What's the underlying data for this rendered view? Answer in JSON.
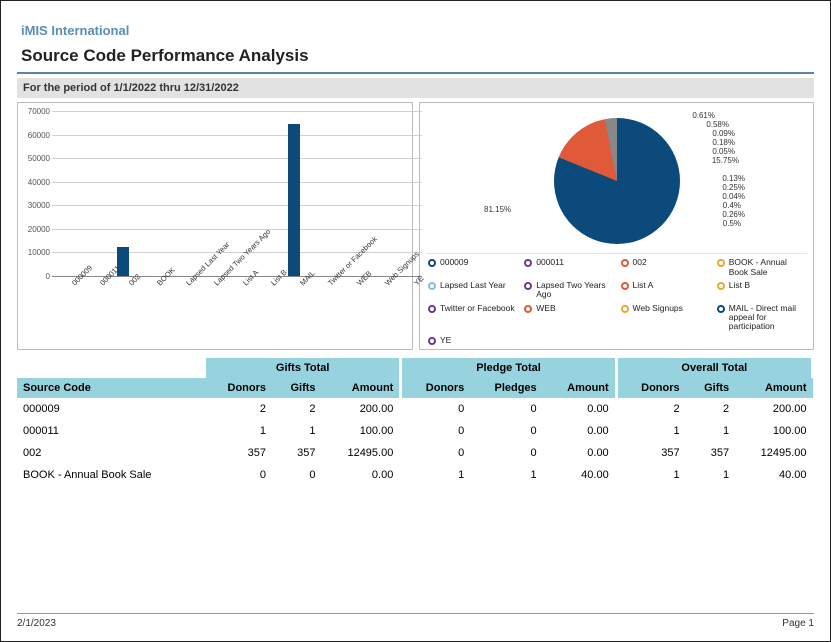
{
  "org_name": "iMIS International",
  "report_title": "Source Code Performance Analysis",
  "period_label": "For the period of 1/1/2022 thru 12/31/2022",
  "footer": {
    "date": "2/1/2023",
    "page": "Page 1"
  },
  "chart_data": [
    {
      "type": "bar",
      "categories": [
        "000009",
        "000011",
        "002",
        "BOOK",
        "Lapsed Last Year",
        "Lapsed Two Years Ago",
        "List A",
        "List B",
        "MAIL",
        "Twitter or Facebook",
        "WEB",
        "Web Signups",
        "YE"
      ],
      "values": [
        200,
        100,
        12495,
        40,
        0,
        0,
        0,
        0,
        64500,
        0,
        0,
        0,
        0
      ],
      "ylim": [
        0,
        70000
      ],
      "yticks": [
        0,
        10000,
        20000,
        30000,
        40000,
        50000,
        60000,
        70000
      ],
      "title": "",
      "xlabel": "",
      "ylabel": ""
    },
    {
      "type": "pie",
      "title": "",
      "series": [
        {
          "name": "000009",
          "value": 0.25,
          "color": "#0b4a7a"
        },
        {
          "name": "000011",
          "value": 0.13,
          "color": "#6b3a8c"
        },
        {
          "name": "002",
          "value": 15.75,
          "color": "#e05a3a"
        },
        {
          "name": "BOOK - Annual Book Sale",
          "value": 0.05,
          "color": "#e8a933"
        },
        {
          "name": "Lapsed Last Year",
          "value": 0.18,
          "color": "#7fbde0"
        },
        {
          "name": "Lapsed Two Years Ago",
          "value": 0.09,
          "color": "#6b3a8c"
        },
        {
          "name": "List A",
          "value": 0.58,
          "color": "#e05a3a"
        },
        {
          "name": "List B",
          "value": 0.61,
          "color": "#e8a933"
        },
        {
          "name": "MAIL - Direct mail appeal for participation",
          "value": 81.15,
          "color": "#0b4a7a"
        },
        {
          "name": "Twitter or Facebook",
          "value": 0.04,
          "color": "#6b3a8c"
        },
        {
          "name": "WEB",
          "value": 0.4,
          "color": "#e05a3a"
        },
        {
          "name": "Web Signups",
          "value": 0.26,
          "color": "#e8a933"
        },
        {
          "name": "YE",
          "value": 0.5,
          "color": "#6b3a8c"
        }
      ],
      "legend_items": [
        "000009",
        "000011",
        "002",
        "BOOK - Annual Book Sale",
        "Lapsed Last Year",
        "Lapsed Two Years Ago",
        "List A",
        "List B",
        "Twitter or Facebook",
        "WEB",
        "Web Signups",
        "MAIL - Direct mail appeal for participation",
        "YE"
      ],
      "main_label": "81.15%",
      "callouts": [
        "0.61%",
        "0.58%",
        "0.09%",
        "0.18%",
        "0.05%",
        "15.75%",
        "0.13%",
        "0.25%",
        "0.04%",
        "0.4%",
        "0.26%",
        "0.5%"
      ]
    }
  ],
  "table": {
    "group_headers": [
      "Gifts Total",
      "Pledge Total",
      "Overall Total"
    ],
    "column_headers": {
      "source": "Source Code",
      "g_donors": "Donors",
      "g_gifts": "Gifts",
      "g_amount": "Amount",
      "p_donors": "Donors",
      "p_pledges": "Pledges",
      "p_amount": "Amount",
      "o_donors": "Donors",
      "o_gifts": "Gifts",
      "o_amount": "Amount"
    },
    "rows": [
      {
        "source": "000009",
        "g_donors": "2",
        "g_gifts": "2",
        "g_amount": "200.00",
        "p_donors": "0",
        "p_pledges": "0",
        "p_amount": "0.00",
        "o_donors": "2",
        "o_gifts": "2",
        "o_amount": "200.00"
      },
      {
        "source": "000011",
        "g_donors": "1",
        "g_gifts": "1",
        "g_amount": "100.00",
        "p_donors": "0",
        "p_pledges": "0",
        "p_amount": "0.00",
        "o_donors": "1",
        "o_gifts": "1",
        "o_amount": "100.00"
      },
      {
        "source": "002",
        "g_donors": "357",
        "g_gifts": "357",
        "g_amount": "12495.00",
        "p_donors": "0",
        "p_pledges": "0",
        "p_amount": "0.00",
        "o_donors": "357",
        "o_gifts": "357",
        "o_amount": "12495.00"
      },
      {
        "source": "BOOK - Annual Book Sale",
        "g_donors": "0",
        "g_gifts": "0",
        "g_amount": "0.00",
        "p_donors": "1",
        "p_pledges": "1",
        "p_amount": "40.00",
        "o_donors": "1",
        "o_gifts": "1",
        "o_amount": "40.00"
      }
    ]
  }
}
